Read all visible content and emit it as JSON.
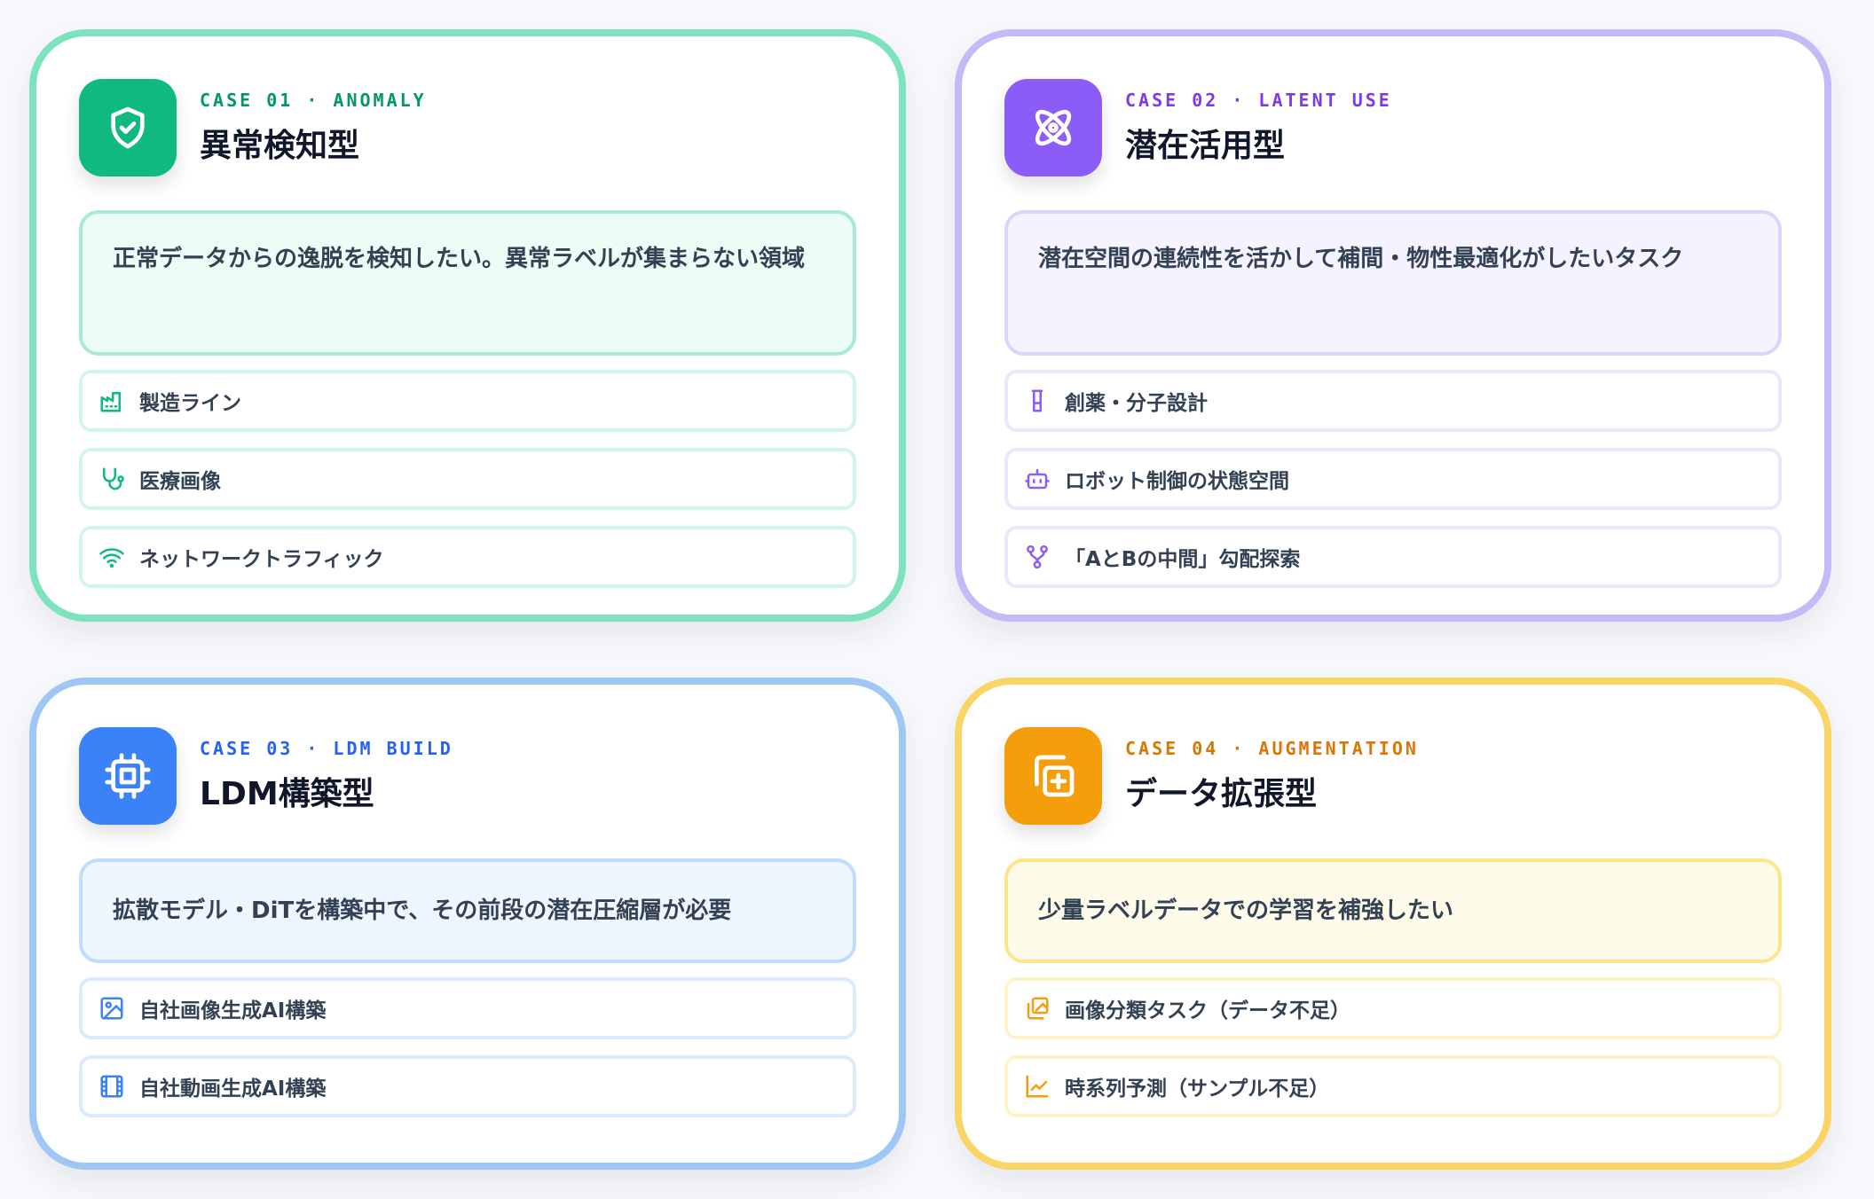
{
  "cards": [
    {
      "kicker": "CASE 01 · ANOMALY",
      "title": "異常検知型",
      "icon": "shield-check-icon",
      "accent": "#10b981",
      "description": "正常データからの逸脱を検知したい。異常ラベルが集まらない領域",
      "items": [
        {
          "icon": "factory-icon",
          "label": "製造ライン"
        },
        {
          "icon": "stethoscope-icon",
          "label": "医療画像"
        },
        {
          "icon": "wifi-icon",
          "label": "ネットワークトラフィック"
        }
      ]
    },
    {
      "kicker": "CASE 02 · LATENT USE",
      "title": "潜在活用型",
      "icon": "atom-icon",
      "accent": "#8b5cf6",
      "description": "潜在空間の連続性を活かして補間・物性最適化がしたいタスク",
      "items": [
        {
          "icon": "flask-icon",
          "label": "創薬・分子設計"
        },
        {
          "icon": "robot-icon",
          "label": "ロボット制御の状態空間"
        },
        {
          "icon": "git-merge-icon",
          "label": "「AとBの中間」勾配探索"
        }
      ]
    },
    {
      "kicker": "CASE 03 · LDM BUILD",
      "title": "LDM構築型",
      "icon": "chip-icon",
      "accent": "#3b82f6",
      "description": "拡散モデル・DiTを構築中で、その前段の潜在圧縮層が必要",
      "items": [
        {
          "icon": "image-icon",
          "label": "自社画像生成AI構築"
        },
        {
          "icon": "film-icon",
          "label": "自社動画生成AI構築"
        }
      ]
    },
    {
      "kicker": "CASE 04 · AUGMENTATION",
      "title": "データ拡張型",
      "icon": "copy-plus-icon",
      "accent": "#f59e0b",
      "description": "少量ラベルデータでの学習を補強したい",
      "items": [
        {
          "icon": "images-icon",
          "label": "画像分類タスク（データ不足）"
        },
        {
          "icon": "line-chart-icon",
          "label": "時系列予測（サンプル不足）"
        }
      ]
    }
  ]
}
